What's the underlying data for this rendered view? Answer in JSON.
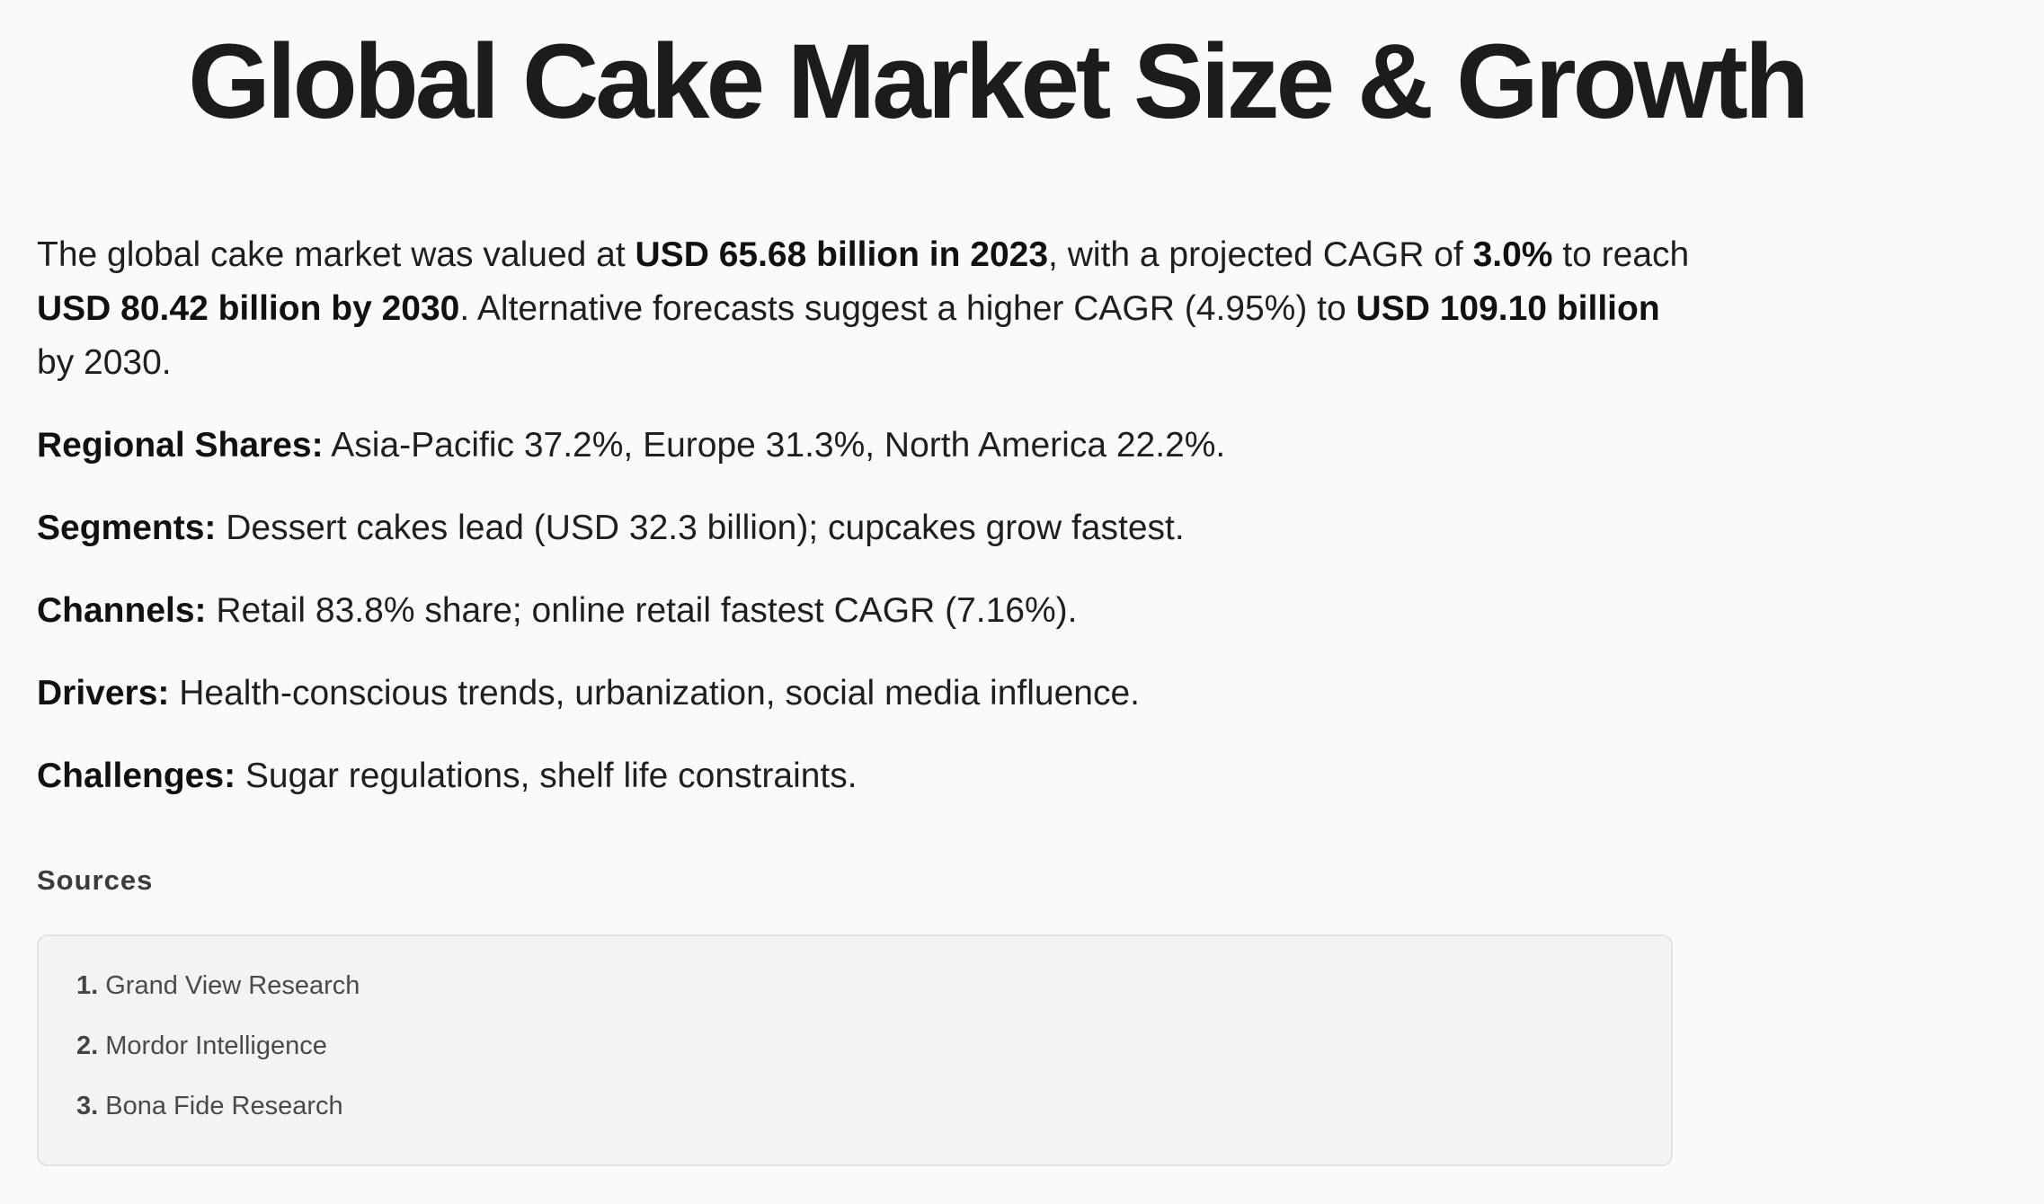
{
  "title": "Global Cake Market Size & Growth",
  "intro": {
    "t1": "The global cake market was valued at ",
    "b1": "USD 65.68 billion in 2023",
    "t2": ", with a projected CAGR of ",
    "b2": "3.0%",
    "t3": " to reach ",
    "b3": "USD 80.42 billion by 2030",
    "t4": ". Alternative forecasts suggest a higher CAGR (4.95%) to ",
    "b4": "USD 109.10 billion",
    "t5": " by 2030."
  },
  "facts": [
    {
      "label": "Regional Shares:",
      "text": " Asia-Pacific 37.2%, Europe 31.3%, North America 22.2%."
    },
    {
      "label": "Segments:",
      "text": " Dessert cakes lead (USD 32.3 billion); cupcakes grow fastest."
    },
    {
      "label": "Channels:",
      "text": " Retail 83.8% share; online retail fastest CAGR (7.16%)."
    },
    {
      "label": "Drivers:",
      "text": " Health-conscious trends, urbanization, social media influence."
    },
    {
      "label": "Challenges:",
      "text": " Sugar regulations, shelf life constraints."
    }
  ],
  "sources": {
    "heading": "Sources",
    "items": [
      {
        "num": "1.",
        "label": "Grand View Research"
      },
      {
        "num": "2.",
        "label": "Mordor Intelligence"
      },
      {
        "num": "3.",
        "label": "Bona Fide Research"
      }
    ]
  }
}
